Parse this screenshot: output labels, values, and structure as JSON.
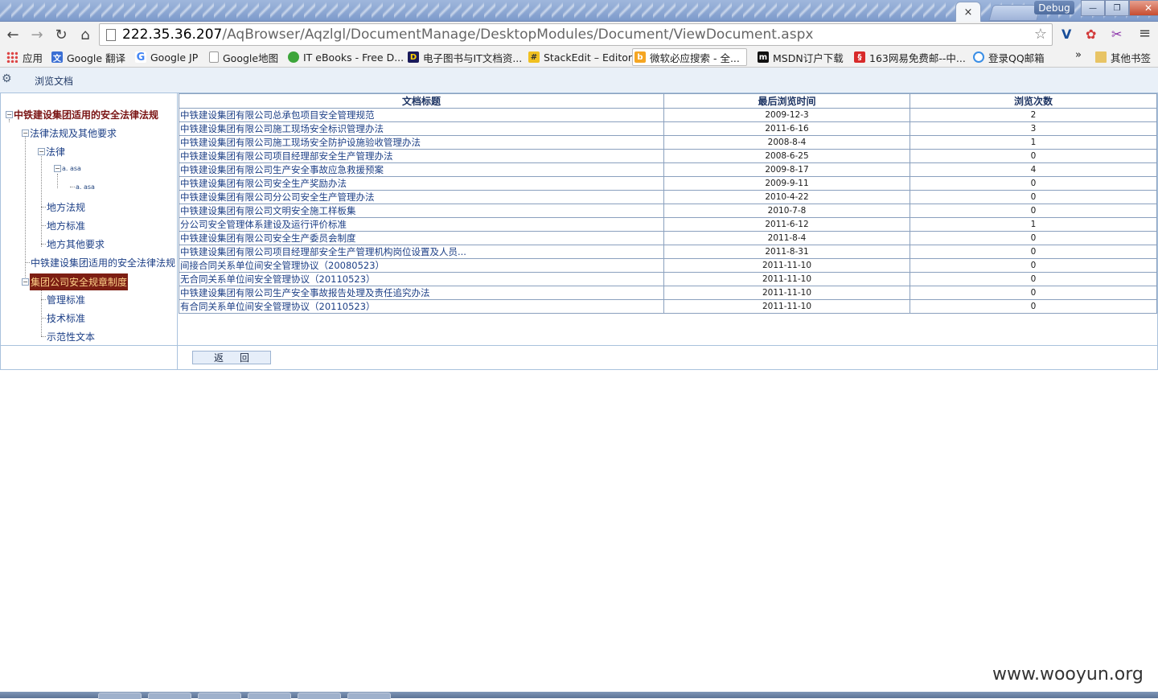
{
  "browser": {
    "tab_close": "×",
    "debug_label": "Debug",
    "window_min": "—",
    "window_restore": "❐",
    "window_close": "✕",
    "nav_back": "←",
    "nav_forward": "→",
    "nav_reload": "↻",
    "nav_home": "⌂",
    "url_host": "222.35.36.207",
    "url_path": "/AqBrowser/Aqzlgl/DocumentManage/DesktopModules/Document/ViewDocument.aspx",
    "star": "☆",
    "menu": "≡"
  },
  "bookmarks": {
    "items": [
      {
        "label": "应用",
        "icon": "apps-icon"
      },
      {
        "label": "Google 翻译",
        "icon": "google-translate-icon"
      },
      {
        "label": "Google JP",
        "icon": "google-icon"
      },
      {
        "label": "Google地图",
        "icon": "page-icon"
      },
      {
        "label": "IT eBooks - Free D...",
        "icon": "green-dot-icon"
      },
      {
        "label": "电子图书与IT文档资...",
        "icon": "ebook-icon"
      },
      {
        "label": "StackEdit – Editor",
        "icon": "stackedit-icon"
      },
      {
        "label": "微软必应搜索 - 全...",
        "icon": "bing-icon"
      },
      {
        "label": "MSDN订户下载",
        "icon": "msdn-icon"
      },
      {
        "label": "163网易免费邮--中...",
        "icon": "mail-163-icon"
      },
      {
        "label": "登录QQ邮箱",
        "icon": "qq-icon"
      }
    ],
    "more": "»",
    "other_label": "其他书签"
  },
  "page": {
    "title": "浏览文档",
    "back_button": "返回"
  },
  "tree": {
    "root": "中铁建设集团适用的安全法律法规",
    "n1": "法律法规及其他要求",
    "n2": "法律",
    "n3": "a. asa",
    "n4": "a. asa",
    "n5": "地方法规",
    "n6": "地方标准",
    "n7": "地方其他要求",
    "n8": "中铁建设集团适用的安全法律法规",
    "n9": "集团公司安全规章制度",
    "n10": "管理标准",
    "n11": "技术标准",
    "n12": "示范性文本"
  },
  "grid": {
    "headers": {
      "title": "文档标题",
      "last_view": "最后浏览时间",
      "count": "浏览次数"
    },
    "rows": [
      {
        "title": "中铁建设集团有限公司总承包项目安全管理规范",
        "date": "2009-12-3",
        "count": "2"
      },
      {
        "title": "中铁建设集团有限公司施工现场安全标识管理办法",
        "date": "2011-6-16",
        "count": "3"
      },
      {
        "title": "中铁建设集团有限公司施工现场安全防护设施验收管理办法",
        "date": "2008-8-4",
        "count": "1"
      },
      {
        "title": "中铁建设集团有限公司项目经理部安全生产管理办法",
        "date": "2008-6-25",
        "count": "0"
      },
      {
        "title": "中铁建设集团有限公司生产安全事故应急救援预案",
        "date": "2009-8-17",
        "count": "4"
      },
      {
        "title": "中铁建设集团有限公司安全生产奖励办法",
        "date": "2009-9-11",
        "count": "0"
      },
      {
        "title": "中铁建设集团有限公司分公司安全生产管理办法",
        "date": "2010-4-22",
        "count": "0"
      },
      {
        "title": "中铁建设集团有限公司文明安全施工样板集",
        "date": "2010-7-8",
        "count": "0"
      },
      {
        "title": "分公司安全管理体系建设及运行评价标准",
        "date": "2011-6-12",
        "count": "1"
      },
      {
        "title": "中铁建设集团有限公司安全生产委员会制度",
        "date": "2011-8-4",
        "count": "0"
      },
      {
        "title": "中铁建设集团有限公司项目经理部安全生产管理机构岗位设置及人员...",
        "date": "2011-8-31",
        "count": "0"
      },
      {
        "title": "间接合同关系单位间安全管理协议（20080523）",
        "date": "2011-11-10",
        "count": "0"
      },
      {
        "title": "无合同关系单位间安全管理协议（20110523）",
        "date": "2011-11-10",
        "count": "0"
      },
      {
        "title": "中铁建设集团有限公司生产安全事故报告处理及责任追究办法",
        "date": "2011-11-10",
        "count": "0"
      },
      {
        "title": "有合同关系单位间安全管理协议（20110523）",
        "date": "2011-11-10",
        "count": "0"
      }
    ]
  },
  "watermark": "www.wooyun.org"
}
